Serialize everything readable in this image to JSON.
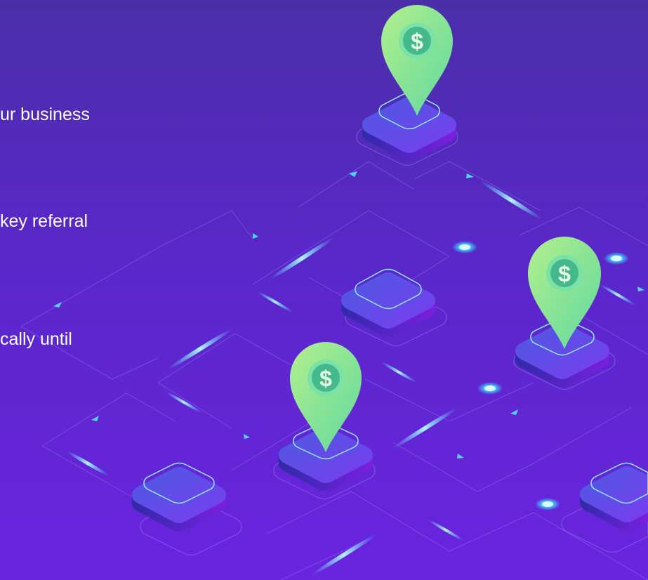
{
  "text": {
    "line_1": "ur business",
    "line_2": "key referral",
    "line_3": "cally until"
  },
  "pins": [
    {
      "symbol": "$"
    },
    {
      "symbol": "$"
    },
    {
      "symbol": "$"
    }
  ],
  "colors": {
    "background_top": "#4a2ea8",
    "background_bottom": "#6a24de",
    "pin_green": "#8ee88a",
    "tile_face": "#4b4bd8",
    "glow_cyan": "#4fd6ff"
  }
}
